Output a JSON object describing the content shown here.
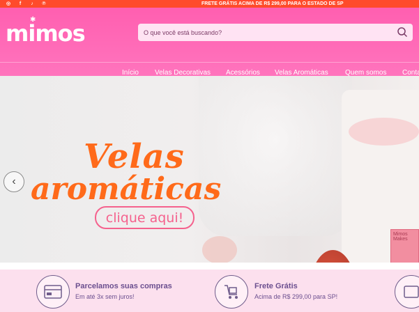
{
  "topbar": {
    "promo": "FRETE GRÁTIS ACIMA DE R$ 299,00 PARA O ESTADO DE SP",
    "social_icons": [
      "instagram-icon",
      "facebook-icon",
      "tiktok-icon",
      "pinterest-icon"
    ]
  },
  "header": {
    "logo": "mimos",
    "search_placeholder": "O que você está buscando?"
  },
  "nav": {
    "items": [
      "Início",
      "Velas Decorativas",
      "Acessórios",
      "Velas Aromáticas",
      "Quem somos",
      "Contato"
    ]
  },
  "hero": {
    "title_line1": "Velas",
    "title_line2": "aromáticas",
    "cta": "clique aqui!",
    "label_text": "Mimos Makes"
  },
  "features": [
    {
      "title": "Parcelamos suas compras",
      "subtitle": "Em até 3x sem juros!"
    },
    {
      "title": "Frete Grátis",
      "subtitle": "Acima de R$ 299,00 para SP!"
    }
  ],
  "colors": {
    "topbar": "#ff4b2b",
    "header": "#ff68b6",
    "hero_title": "#ff6a1a",
    "cta": "#f5618d",
    "features_bg": "#fce0ee",
    "features_text": "#6b4f8f"
  }
}
